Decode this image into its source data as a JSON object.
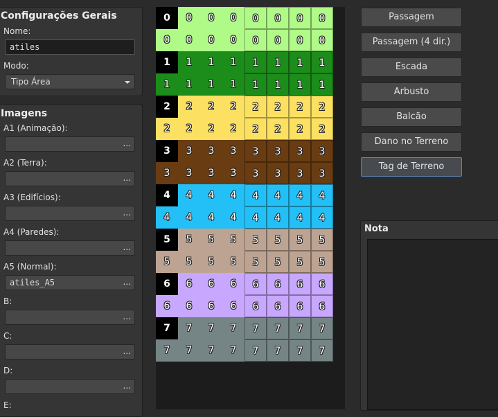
{
  "general": {
    "title": "Configurações Gerais",
    "name_label": "Nome:",
    "name_value": "atiles",
    "mode_label": "Modo:",
    "mode_value": "Tipo Área"
  },
  "images": {
    "title": "Imagens",
    "dots": "...",
    "slots": [
      {
        "label": "A1 (Animação):",
        "value": ""
      },
      {
        "label": "A2 (Terra):",
        "value": ""
      },
      {
        "label": "A3 (Edifícios):",
        "value": ""
      },
      {
        "label": "A4 (Paredes):",
        "value": ""
      },
      {
        "label": "A5 (Normal):",
        "value": "atiles_A5"
      },
      {
        "label": "B:",
        "value": ""
      },
      {
        "label": "C:",
        "value": ""
      },
      {
        "label": "D:",
        "value": ""
      },
      {
        "label": "E:",
        "value": ""
      }
    ]
  },
  "tile_rows": [
    {
      "label": "0",
      "color": "#b0fa88",
      "text": "#ffffff"
    },
    {
      "label": "1",
      "color": "#1c8c1a",
      "text": "#ffffff"
    },
    {
      "label": "2",
      "color": "#fce062",
      "text": "#ffffff"
    },
    {
      "label": "3",
      "color": "#6a3c12",
      "text": "#ffffff"
    },
    {
      "label": "4",
      "color": "#22c0f6",
      "text": "#ffffff"
    },
    {
      "label": "5",
      "color": "#bda492",
      "text": "#ffffff"
    },
    {
      "label": "6",
      "color": "#c8a8ff",
      "text": "#ffffff"
    },
    {
      "label": "7",
      "color": "#758585",
      "text": "#ffffff"
    }
  ],
  "buttons": [
    {
      "label": "Passagem"
    },
    {
      "label": "Passagem (4 dir.)"
    },
    {
      "label": "Escada"
    },
    {
      "label": "Arbusto"
    },
    {
      "label": "Balcão"
    },
    {
      "label": "Dano no Terreno"
    },
    {
      "label": "Tag de Terreno"
    }
  ],
  "note": {
    "title": "Nota"
  }
}
